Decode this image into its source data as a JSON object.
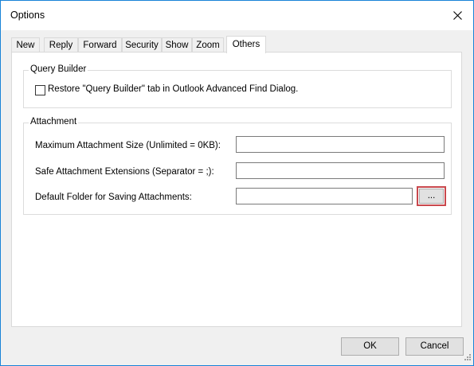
{
  "window": {
    "title": "Options",
    "close_icon": "close-icon"
  },
  "tabs": [
    {
      "label": "New"
    },
    {
      "label": "Reply"
    },
    {
      "label": "Forward"
    },
    {
      "label": "Security"
    },
    {
      "label": "Show"
    },
    {
      "label": "Zoom"
    },
    {
      "label": "Others",
      "active": true
    }
  ],
  "query_builder": {
    "legend": "Query Builder",
    "restore_checkbox": {
      "label": "Restore \"Query Builder\" tab in Outlook Advanced Find Dialog.",
      "checked": false
    }
  },
  "attachment": {
    "legend": "Attachment",
    "max_size_label": "Maximum Attachment Size (Unlimited = 0KB):",
    "max_size_value": "",
    "safe_ext_label": "Safe Attachment Extensions (Separator = ;):",
    "safe_ext_value": "",
    "default_folder_label": "Default Folder for Saving Attachments:",
    "default_folder_value": "",
    "browse_label": "..."
  },
  "footer": {
    "ok_label": "OK",
    "cancel_label": "Cancel"
  },
  "colors": {
    "window_border": "#1883d7",
    "highlight": "#c9484d"
  }
}
